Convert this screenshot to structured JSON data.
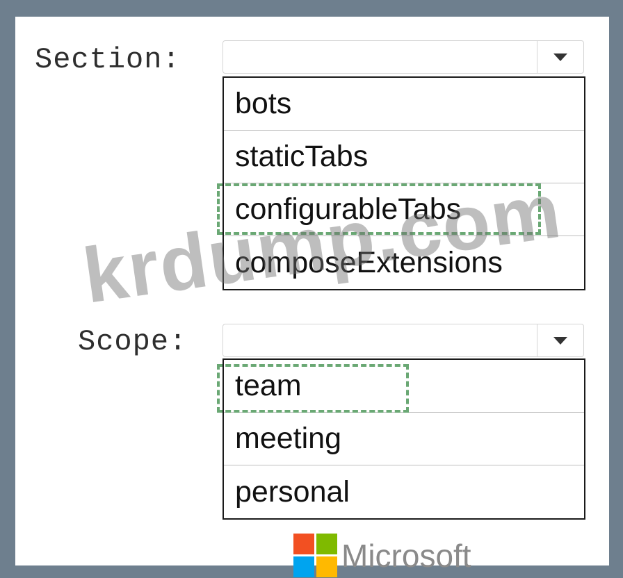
{
  "section": {
    "label": "Section:",
    "selected": "",
    "options": [
      "bots",
      "staticTabs",
      "configurableTabs",
      "composeExtensions"
    ],
    "highlighted": "configurableTabs"
  },
  "scope": {
    "label": "Scope:",
    "selected": "",
    "options": [
      "team",
      "meeting",
      "personal"
    ],
    "highlighted": "team"
  },
  "watermark": "krdump.com",
  "brand": {
    "name": "Microsoft",
    "logo_colors": [
      "#f25022",
      "#7fba00",
      "#00a4ef",
      "#ffb900"
    ]
  }
}
